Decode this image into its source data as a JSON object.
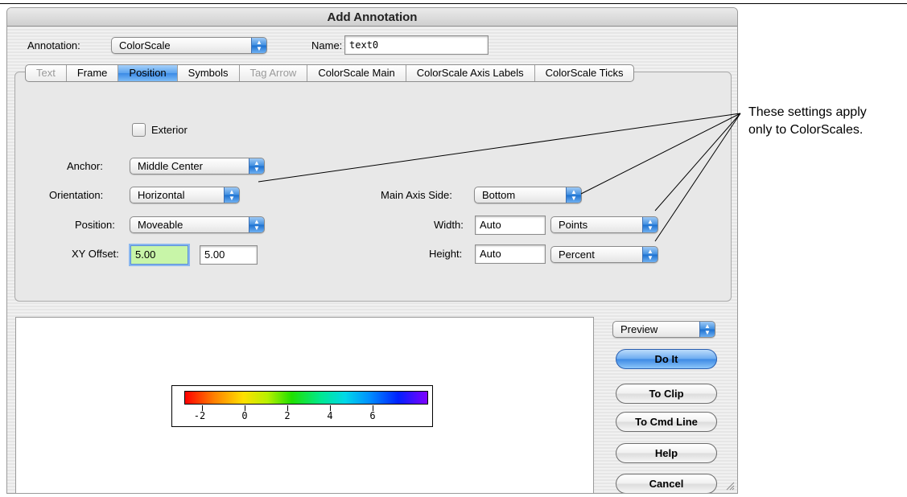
{
  "window": {
    "title": "Add Annotation"
  },
  "header": {
    "annotation_label": "Annotation:",
    "annotation_value": "ColorScale",
    "name_label": "Name:",
    "name_value": "text0"
  },
  "tabs": [
    {
      "label": "Text",
      "state": "disabled"
    },
    {
      "label": "Frame",
      "state": "normal"
    },
    {
      "label": "Position",
      "state": "active"
    },
    {
      "label": "Symbols",
      "state": "normal"
    },
    {
      "label": "Tag Arrow",
      "state": "disabled"
    },
    {
      "label": "ColorScale Main",
      "state": "normal"
    },
    {
      "label": "ColorScale Axis Labels",
      "state": "normal"
    },
    {
      "label": "ColorScale Ticks",
      "state": "normal"
    }
  ],
  "position_panel": {
    "exterior_label": "Exterior",
    "exterior_checked": false,
    "anchor_label": "Anchor:",
    "anchor_value": "Middle Center",
    "orientation_label": "Orientation:",
    "orientation_value": "Horizontal",
    "position_label": "Position:",
    "position_value": "Moveable",
    "xy_offset_label": "XY Offset:",
    "x_offset": "5.00",
    "y_offset": "5.00",
    "main_axis_side_label": "Main Axis Side:",
    "main_axis_side_value": "Bottom",
    "width_label": "Width:",
    "width_value": "Auto",
    "width_units": "Points",
    "height_label": "Height:",
    "height_value": "Auto",
    "height_units": "Percent"
  },
  "preview": {
    "colorscale_tick_labels": [
      "-2",
      "0",
      "2",
      "4",
      "6"
    ]
  },
  "side_buttons": {
    "preview_select": "Preview",
    "do_it": "Do It",
    "to_clip": "To Clip",
    "to_cmd_line": "To Cmd Line",
    "help": "Help",
    "cancel": "Cancel"
  },
  "callout": {
    "line1": "These settings apply",
    "line2": "only to ColorScales."
  },
  "colors": {
    "accent_blue": "#3b8ae6",
    "focus_field": "#c8f5a8"
  }
}
